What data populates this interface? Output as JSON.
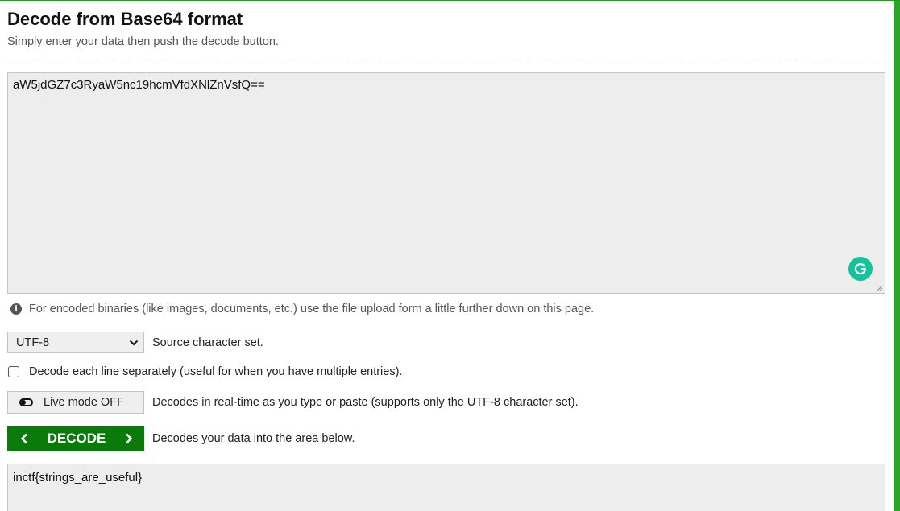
{
  "header": {
    "title": "Decode from Base64 format",
    "subtitle": "Simply enter your data then push the decode button."
  },
  "input": {
    "value": "aW5jdGZ7c3RyaW5nc19hcmVfdXNlZnVsfQ=="
  },
  "info": {
    "text": "For encoded binaries (like images, documents, etc.) use the file upload form a little further down on this page."
  },
  "charset": {
    "selected": "UTF-8",
    "label": "Source character set."
  },
  "each_line": {
    "label": "Decode each line separately (useful for when you have multiple entries).",
    "checked": false
  },
  "live_mode": {
    "button_label": "Live mode OFF",
    "description": "Decodes in real-time as you type or paste (supports only the UTF-8 character set)."
  },
  "decode": {
    "button_label": "DECODE",
    "description": "Decodes your data into the area below."
  },
  "output": {
    "value": "inctf{strings_are_useful}"
  },
  "colors": {
    "accent": "#0a7a0a",
    "grammarly": "#15c39a",
    "edge": "#2aa52a"
  }
}
